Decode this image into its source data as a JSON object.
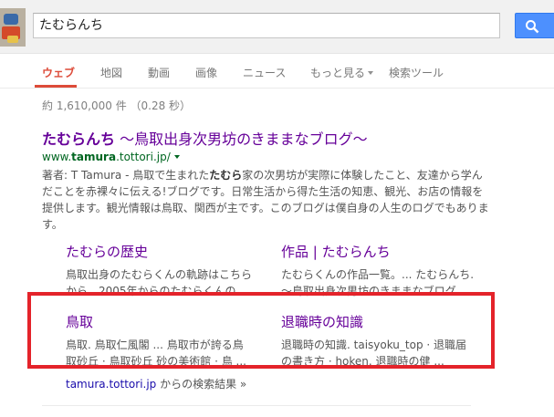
{
  "search": {
    "query": "たむらんち",
    "button_icon": "magnifier-icon"
  },
  "tabs": [
    {
      "label": "ウェブ",
      "active": true
    },
    {
      "label": "地図"
    },
    {
      "label": "動画"
    },
    {
      "label": "画像"
    },
    {
      "label": "ニュース"
    },
    {
      "label": "もっと見る"
    },
    {
      "label": "検索ツール"
    }
  ],
  "stats": "約 1,610,000 件 （0.28 秒）",
  "result": {
    "title_bold": "たむらんち",
    "title_rest": " ～鳥取出身次男坊のきままなブログ～",
    "url_prefix": "www.",
    "url_bold": "tamura",
    "url_suffix": ".tottori.jp/",
    "snippet": {
      "line1_pre": "著者: T Tamura - 鳥取で生まれた",
      "line1_bold": "たむら",
      "line1_post": "家の次男坊が実際に体験したこと、友達から学ん",
      "line2": "だことを赤裸々に伝える!ブログです。日常生活から得た生活の知恵、観光、お店の情報を",
      "line3": "提供します。観光情報は鳥取、関西が主です。このブログは僕自身の人生のログでもありま",
      "line4": "す。"
    }
  },
  "sitelinks": [
    {
      "title": "たむらの歴史",
      "desc": [
        "鳥取出身のたむらくんの軌跡はこちら",
        "から。2005年からのたむらくんの ..."
      ]
    },
    {
      "title": "作品 | たむらんち",
      "desc": [
        "たむらくんの作品一覧。... たむらんち.",
        "～鳥取出身次男坊のきままなブログ ..."
      ]
    },
    {
      "title": "鳥取",
      "desc": [
        "鳥取. 鳥取仁風閣 ... 鳥取市が誇る鳥",
        "取砂丘 · 鳥取砂丘 砂の美術館 · 鳥 ..."
      ]
    },
    {
      "title": "退職時の知識",
      "desc": [
        "退職時の知識. taisyoku_top · 退職届",
        "の書き方 · hoken. 退職時の健 ..."
      ]
    }
  ],
  "more_results": {
    "site": "tamura.tottori.jp",
    "suffix": " からの検索結果 »"
  },
  "colors": {
    "highlight": "#e4232a",
    "visited_link": "#660099",
    "url": "#006621",
    "active_tab": "#dd4b39"
  }
}
